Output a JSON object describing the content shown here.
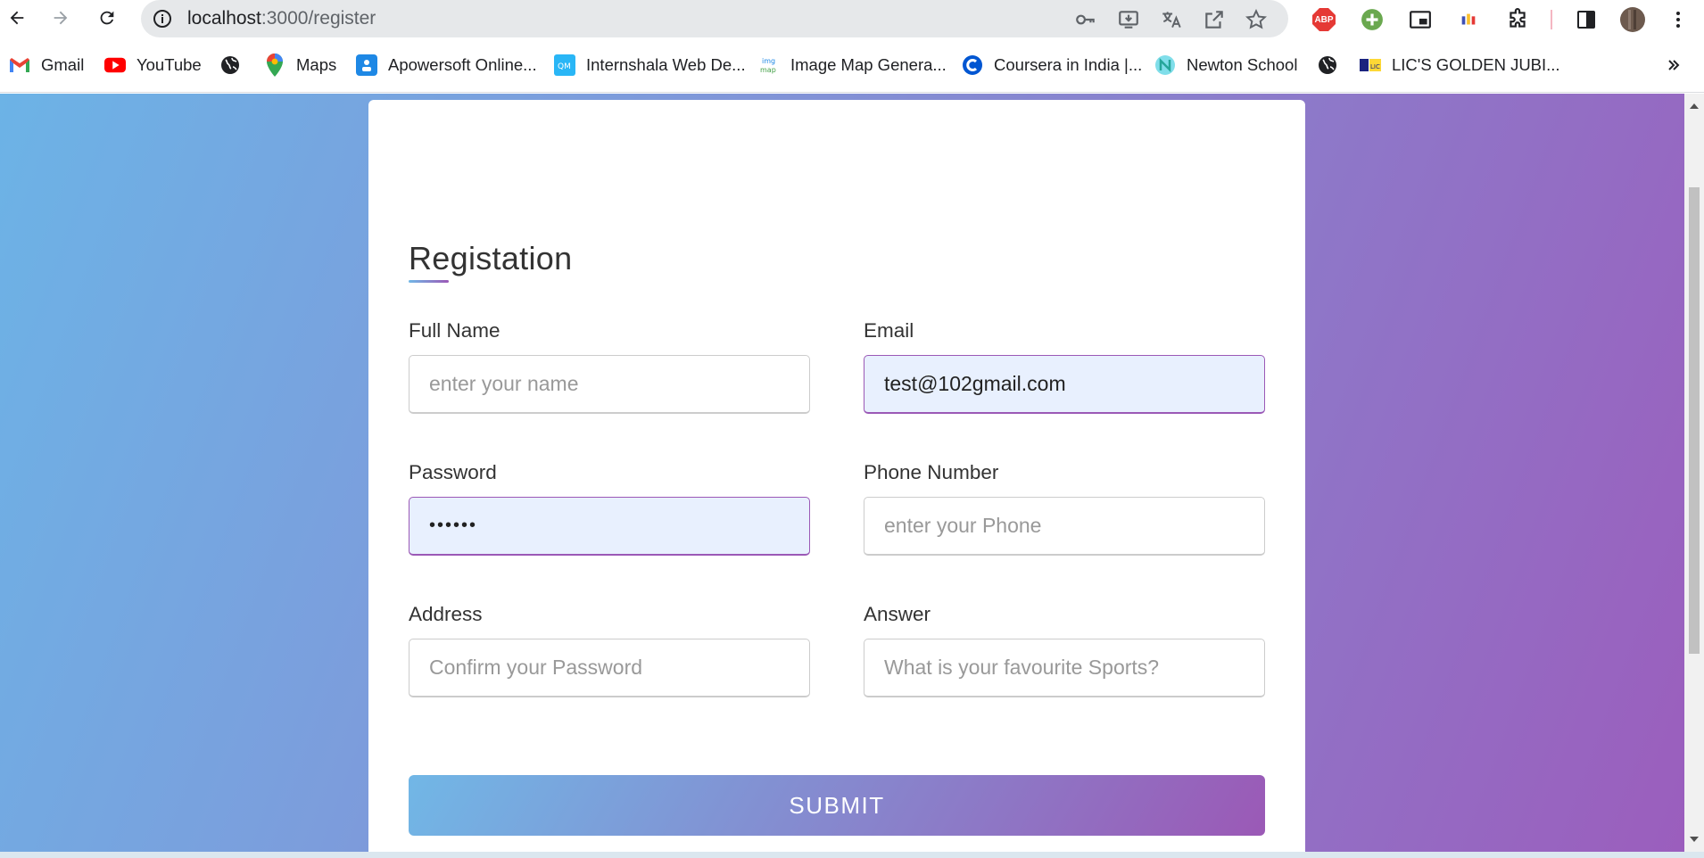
{
  "browser": {
    "url_host": "localhost",
    "url_path": ":3000/register"
  },
  "bookmarks": [
    {
      "label": "Gmail",
      "icon": "gmail-icon"
    },
    {
      "label": "YouTube",
      "icon": "youtube-icon"
    },
    {
      "label": "",
      "icon": "globe-icon"
    },
    {
      "label": "Maps",
      "icon": "maps-icon"
    },
    {
      "label": "Apowersoft Online...",
      "icon": "apowersoft-icon"
    },
    {
      "label": "Internshala Web De...",
      "icon": "internshala-icon"
    },
    {
      "label": "Image Map Genera...",
      "icon": "imgmap-icon"
    },
    {
      "label": "Coursera in India |...",
      "icon": "coursera-icon"
    },
    {
      "label": "Newton School",
      "icon": "newton-icon"
    },
    {
      "label": "",
      "icon": "globe-icon"
    },
    {
      "label": "LIC'S GOLDEN JUBI...",
      "icon": "lic-icon"
    }
  ],
  "extensions": {
    "abp_label": "ABP"
  },
  "form": {
    "title": "Registation",
    "full_name": {
      "label": "Full Name",
      "placeholder": "enter your name",
      "value": ""
    },
    "email": {
      "label": "Email",
      "placeholder": "",
      "value": "test@102gmail.com"
    },
    "password": {
      "label": "Password",
      "value": "••••••"
    },
    "phone": {
      "label": "Phone Number",
      "placeholder": "enter your Phone",
      "value": ""
    },
    "address": {
      "label": "Address",
      "placeholder": "Confirm your Password",
      "value": ""
    },
    "answer": {
      "label": "Answer",
      "placeholder": "What is your favourite Sports?",
      "value": ""
    },
    "submit_label": "SUBMIT"
  },
  "colors": {
    "gradient_start": "#71b7e6",
    "gradient_end": "#9b59b6",
    "autofill_bg": "#e8f0fe"
  }
}
